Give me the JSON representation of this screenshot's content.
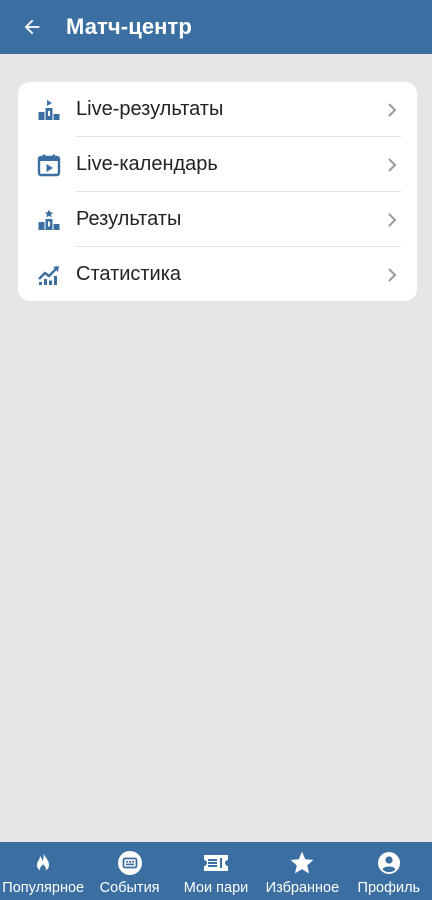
{
  "header": {
    "title": "Матч-центр",
    "back_icon": "arrow-left-icon"
  },
  "menu": {
    "items": [
      {
        "label": "Live-результаты",
        "icon": "live-podium-icon"
      },
      {
        "label": "Live-календарь",
        "icon": "calendar-play-icon"
      },
      {
        "label": "Результаты",
        "icon": "podium-star-icon"
      },
      {
        "label": "Статистика",
        "icon": "chart-trend-icon"
      }
    ],
    "chevron_icon": "chevron-right-icon"
  },
  "bottom_nav": {
    "tabs": [
      {
        "label": "Популярное",
        "icon": "flame-icon"
      },
      {
        "label": "События",
        "icon": "scoreboard-icon"
      },
      {
        "label": "Мои пари",
        "icon": "ticket-icon"
      },
      {
        "label": "Избранное",
        "icon": "star-icon"
      },
      {
        "label": "Профиль",
        "icon": "user-icon"
      }
    ]
  },
  "colors": {
    "primary": "#3b6fa1",
    "background": "#e6e6e6",
    "card": "#ffffff",
    "text": "#222222",
    "chevron": "#9a9a9a"
  }
}
